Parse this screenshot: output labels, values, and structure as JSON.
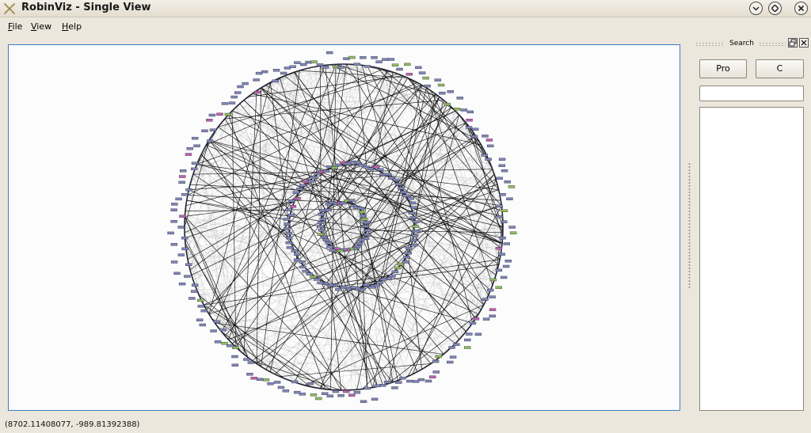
{
  "window": {
    "title": "RobinViz - Single View"
  },
  "menubar": {
    "items": [
      {
        "mnemonic": "F",
        "rest": "ile"
      },
      {
        "mnemonic": "V",
        "rest": "iew"
      },
      {
        "mnemonic": "H",
        "rest": "elp"
      }
    ]
  },
  "dock": {
    "title": "Search",
    "buttons": [
      "Pro",
      "C"
    ],
    "search_value": ""
  },
  "status": {
    "coordinates": "(8702.11408077, -989.81392388)"
  },
  "colors": {
    "frame_border": "#3b7fbf",
    "node_default": "#7f86b8",
    "node_green": "#8fbf5a",
    "node_magenta": "#c060b0",
    "edge": "#000000"
  }
}
